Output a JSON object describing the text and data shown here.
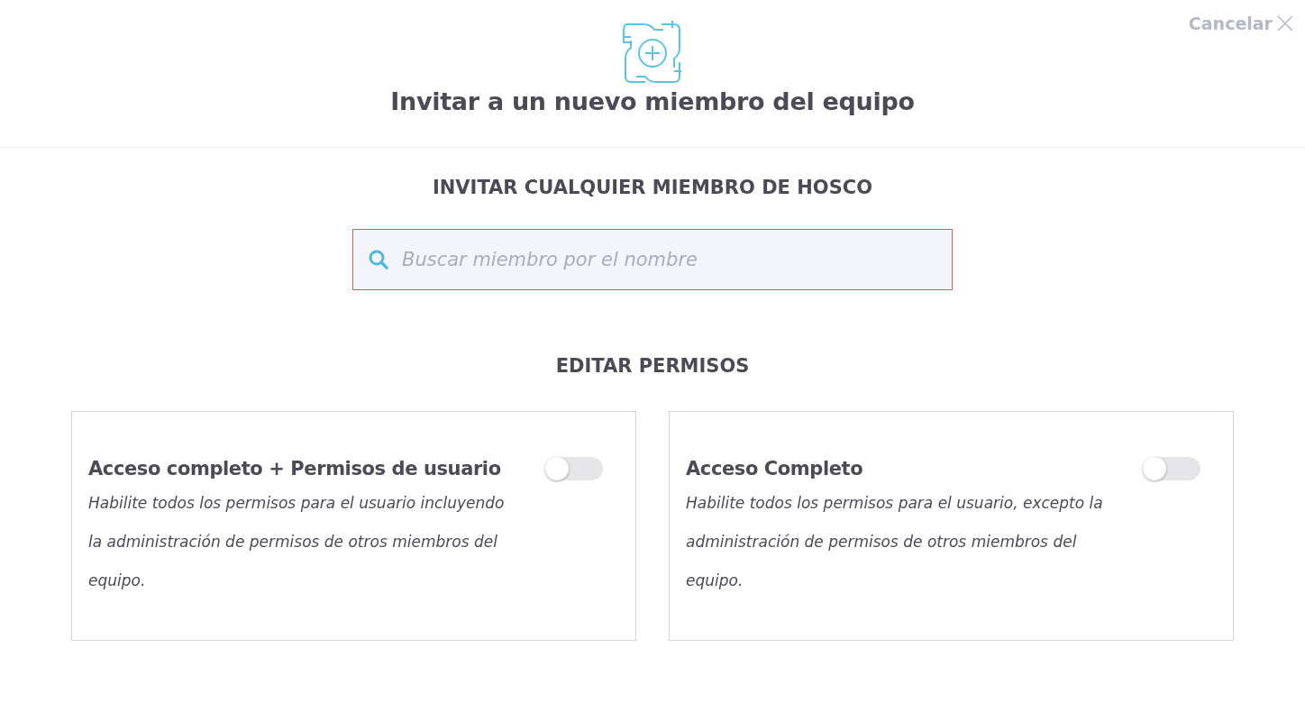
{
  "header": {
    "cancel_label": "Cancelar",
    "title": "Invitar a un nuevo miembro del equipo"
  },
  "invite": {
    "heading": "INVITAR CUALQUIER MIEMBRO DE HOSCO",
    "search": {
      "placeholder": "Buscar miembro por el nombre"
    }
  },
  "permissions": {
    "heading": "EDITAR PERMISOS",
    "options": [
      {
        "title": "Acceso completo + Permisos de usuario",
        "on": false,
        "description": "Habilite todos los permisos para el usuario incluyendo la administración de permisos de otros miembros del equipo."
      },
      {
        "title": "Acceso Completo",
        "on": false,
        "description": "Habilite todos los permisos para el usuario, excepto la administración de permisos de otros miembros del equipo."
      }
    ]
  }
}
